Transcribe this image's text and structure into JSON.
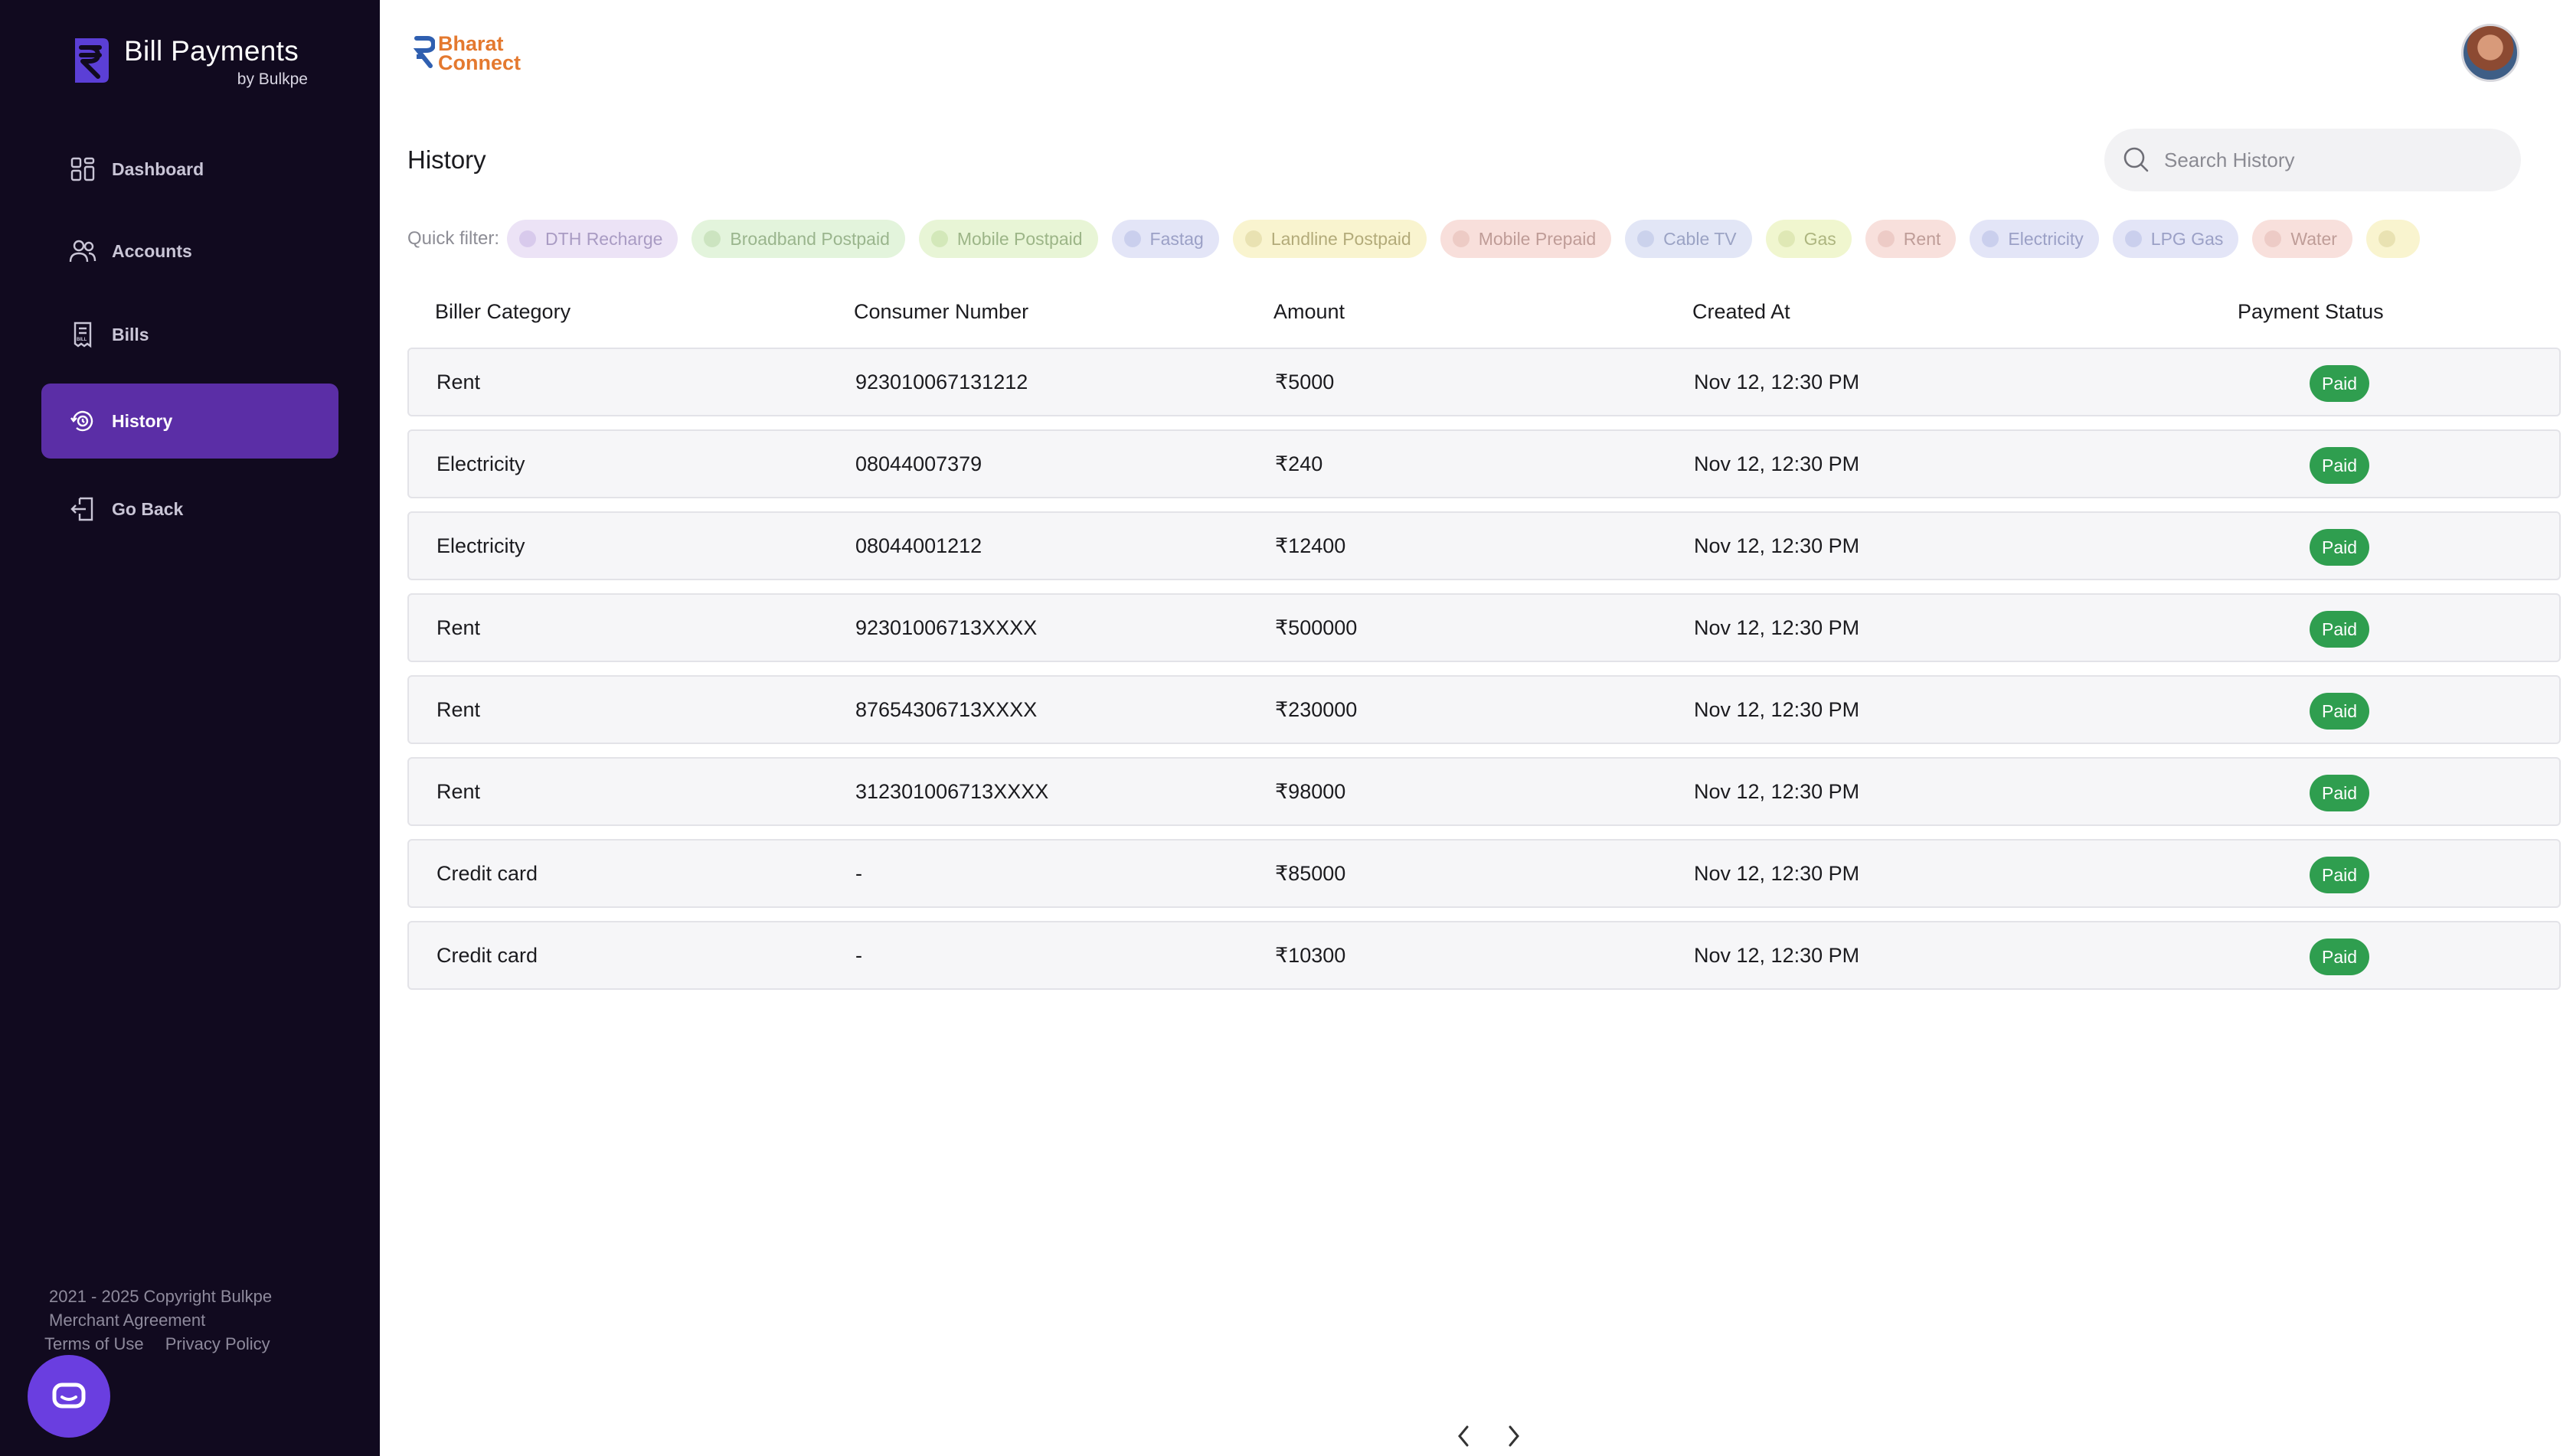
{
  "app": {
    "title": "Bill Payments",
    "subtitle": "by Bulkpe"
  },
  "sidebar": {
    "items": [
      {
        "label": "Dashboard",
        "icon": "dashboard-icon",
        "active": false
      },
      {
        "label": "Accounts",
        "icon": "users-icon",
        "active": false
      },
      {
        "label": "Bills",
        "icon": "bill-icon",
        "active": false
      },
      {
        "label": "History",
        "icon": "history-icon",
        "active": true
      },
      {
        "label": "Go Back",
        "icon": "logout-icon",
        "active": false
      }
    ],
    "footer": {
      "copyright": "2021 - 2025 Copyright Bulkpe",
      "agreement": "Merchant Agreement",
      "terms": "Terms of Use",
      "privacy": "Privacy Policy"
    }
  },
  "header": {
    "logo_line1": "Bharat",
    "logo_line2": "Connect"
  },
  "page": {
    "title": "History",
    "search_placeholder": "Search History"
  },
  "quick_filter": {
    "label": "Quick filter:",
    "chips": [
      {
        "label": "DTH Recharge",
        "bg": "#ece3f6",
        "fg": "#a99bc3",
        "dot": "#c9b6e4"
      },
      {
        "label": "Broadband Postpaid",
        "bg": "#e3f4dc",
        "fg": "#9ab58d",
        "dot": "#b9d7aa"
      },
      {
        "label": "Mobile Postpaid",
        "bg": "#e8f5d6",
        "fg": "#9cb587",
        "dot": "#c1dca3"
      },
      {
        "label": "Fastag",
        "bg": "#e3e5f7",
        "fg": "#9ba0c6",
        "dot": "#b7bde6"
      },
      {
        "label": "Landline Postpaid",
        "bg": "#f9f4cf",
        "fg": "#b3ab7a",
        "dot": "#ddd39a"
      },
      {
        "label": "Mobile Prepaid",
        "bg": "#f8dfdb",
        "fg": "#bf9c97",
        "dot": "#e3b9b3"
      },
      {
        "label": "Cable TV",
        "bg": "#e2e6f6",
        "fg": "#9ba3c4",
        "dot": "#b8c1e3"
      },
      {
        "label": "Gas",
        "bg": "#f0f6cf",
        "fg": "#adb57f",
        "dot": "#d2dca0"
      },
      {
        "label": "Rent",
        "bg": "#f8e0dc",
        "fg": "#bf9d98",
        "dot": "#e3bab4"
      },
      {
        "label": "Electricity",
        "bg": "#e3e5f7",
        "fg": "#9ba0c6",
        "dot": "#b7bde6"
      },
      {
        "label": "LPG Gas",
        "bg": "#e3e5f7",
        "fg": "#9ba0c6",
        "dot": "#b7bde6"
      },
      {
        "label": "Water",
        "bg": "#f8e0dc",
        "fg": "#bf9d98",
        "dot": "#e3bab4"
      },
      {
        "label": "",
        "bg": "#f9f4cf",
        "fg": "#b3ab7a",
        "dot": "#ddd39a"
      }
    ]
  },
  "table": {
    "headers": {
      "category": "Biller Category",
      "consumer": "Consumer Number",
      "amount": "Amount",
      "created": "Created At",
      "status": "Payment Status"
    },
    "rows": [
      {
        "category": "Rent",
        "consumer": "923010067131212",
        "amount": "₹5000",
        "created": "Nov 12, 12:30 PM",
        "status": "Paid"
      },
      {
        "category": "Electricity",
        "consumer": "08044007379",
        "amount": "₹240",
        "created": "Nov 12, 12:30 PM",
        "status": "Paid"
      },
      {
        "category": "Electricity",
        "consumer": "08044001212",
        "amount": "₹12400",
        "created": "Nov 12, 12:30 PM",
        "status": "Paid"
      },
      {
        "category": "Rent",
        "consumer": "92301006713XXXX",
        "amount": "₹500000",
        "created": "Nov 12, 12:30 PM",
        "status": "Paid"
      },
      {
        "category": "Rent",
        "consumer": "87654306713XXXX",
        "amount": "₹230000",
        "created": "Nov 12, 12:30 PM",
        "status": "Paid"
      },
      {
        "category": "Rent",
        "consumer": "312301006713XXXX",
        "amount": "₹98000",
        "created": "Nov 12, 12:30 PM",
        "status": "Paid"
      },
      {
        "category": "Credit card",
        "consumer": "-",
        "amount": "₹85000",
        "created": "Nov 12, 12:30 PM",
        "status": "Paid"
      },
      {
        "category": "Credit card",
        "consumer": "-",
        "amount": "₹10300",
        "created": "Nov 12, 12:30 PM",
        "status": "Paid"
      }
    ]
  },
  "colors": {
    "sidebar_bg": "#110a1f",
    "active_nav": "#5b2ea6",
    "paid_badge": "#2f9e4f",
    "chat_fab": "#6a3ee0"
  }
}
